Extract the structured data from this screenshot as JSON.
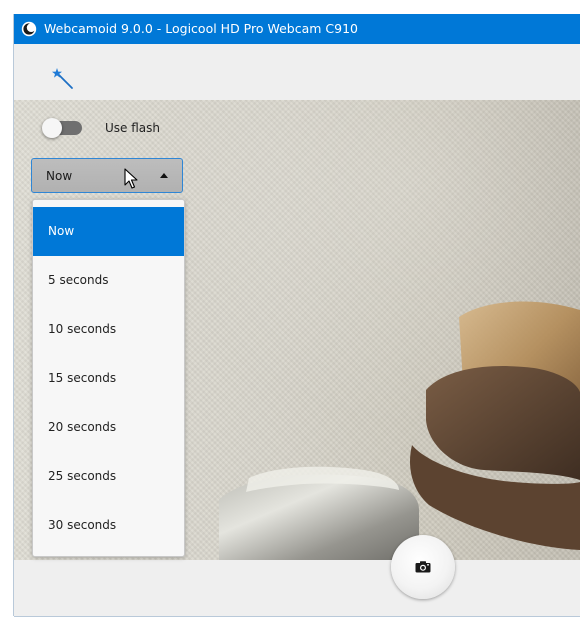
{
  "window": {
    "title": "Webcamoid 9.0.0 - Logicool HD Pro Webcam C910",
    "app_icon": "webcamoid-logo-icon"
  },
  "toolbar": {
    "effects_icon": "magic-wand-icon"
  },
  "settings": {
    "flash": {
      "label": "Use flash",
      "enabled": false
    },
    "timer": {
      "selected": "Now",
      "options": [
        "Now",
        "5 seconds",
        "10 seconds",
        "15 seconds",
        "20 seconds",
        "25 seconds",
        "30 seconds"
      ]
    }
  },
  "capture": {
    "icon": "camera-icon"
  },
  "colors": {
    "titlebar": "#0078d7",
    "accent": "#0078d7",
    "combo_border": "#2f86d5"
  }
}
